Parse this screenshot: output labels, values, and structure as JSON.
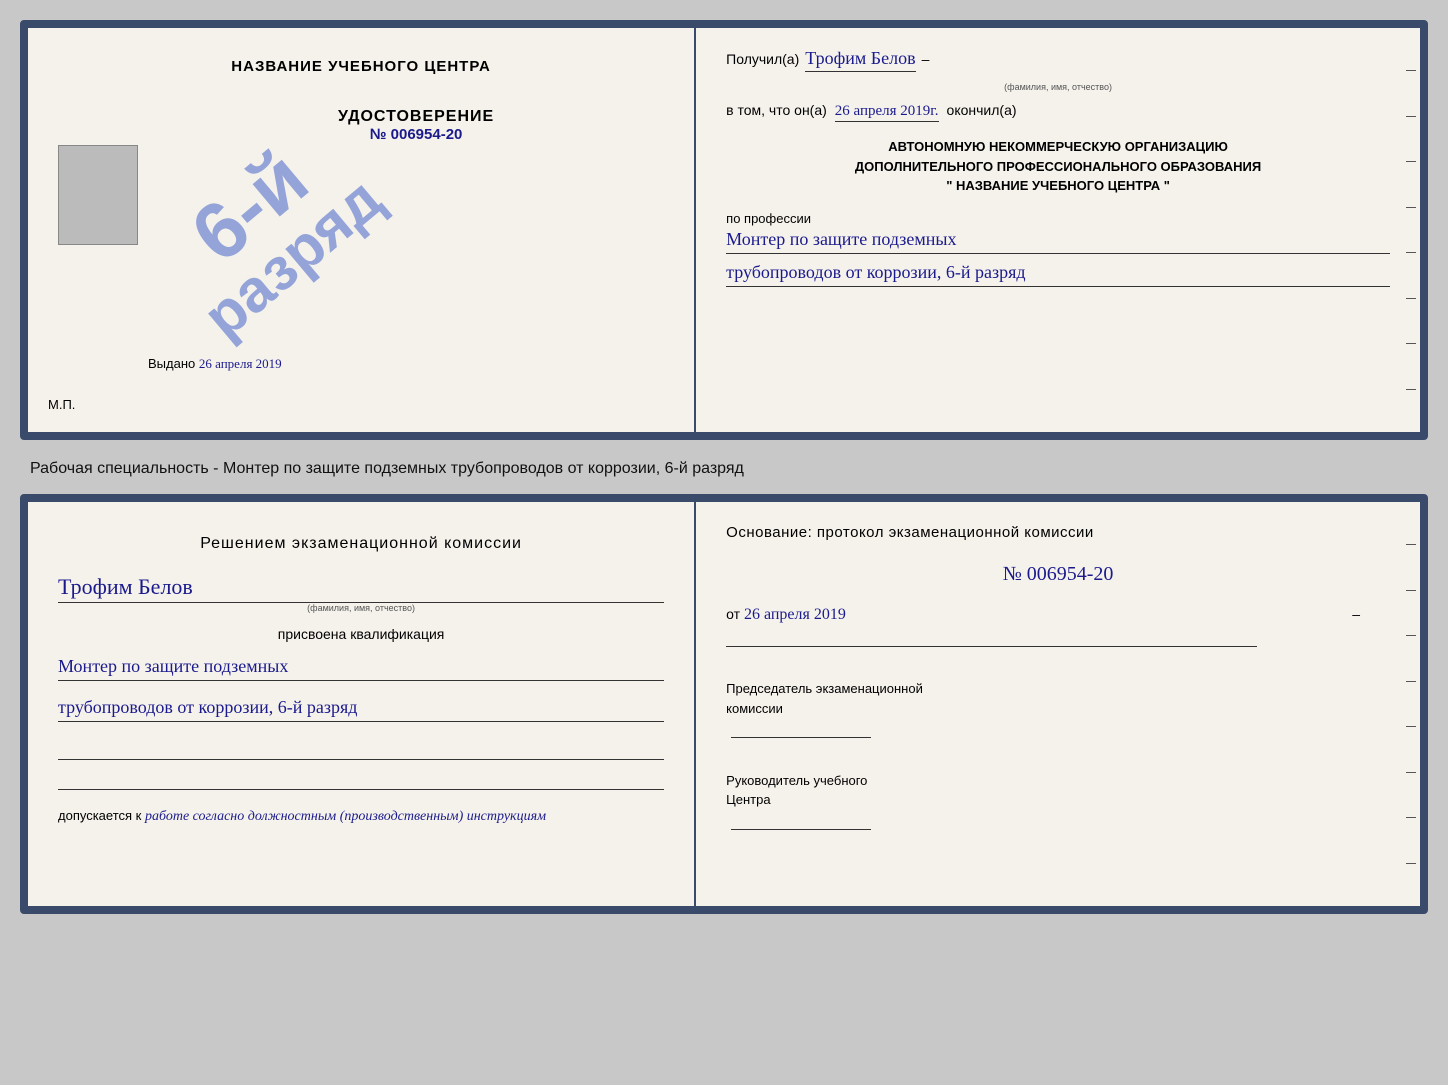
{
  "page": {
    "background": "#c8c8c8"
  },
  "top_cert": {
    "left": {
      "school_name": "НАЗВАНИЕ УЧЕБНОГО ЦЕНТРА",
      "udostoverenie_title": "УДОСТОВЕРЕНИЕ",
      "udostoverenie_number": "№ 006954-20",
      "stamp_line1": "6-й",
      "stamp_line2": "разряд",
      "vydano_label": "Выдано",
      "vydano_date": "26 апреля 2019",
      "mp_label": "М.П."
    },
    "right": {
      "poluchil_label": "Получил(а)",
      "recipient_name": "Трофим Белов",
      "recipient_caption": "(фамилия, имя, отчество)",
      "dash": "–",
      "vtom_label": "в том, что он(а)",
      "date_handwritten": "26 апреля 2019г.",
      "okonchil_label": "окончил(а)",
      "org_line1": "АВТОНОМНУЮ НЕКОММЕРЧЕСКУЮ ОРГАНИЗАЦИЮ",
      "org_line2": "ДОПОЛНИТЕЛЬНОГО ПРОФЕССИОНАЛЬНОГО ОБРАЗОВАНИЯ",
      "org_line3": "\"  НАЗВАНИЕ УЧЕБНОГО ЦЕНТРА  \"",
      "po_professii": "по профессии",
      "profession_line1": "Монтер по защите подземных",
      "profession_line2": "трубопроводов от коррозии, 6-й разряд"
    }
  },
  "between_text": "Рабочая специальность - Монтер по защите подземных трубопроводов от коррозии, 6-й разряд",
  "bottom_cert": {
    "left": {
      "resheniyem_title": "Решением экзаменационной комиссии",
      "name_handwritten": "Трофим Белов",
      "name_caption": "(фамилия, имя, отчество)",
      "prisvoena_label": "присвоена квалификация",
      "qual_line1": "Монтер по защите подземных",
      "qual_line2": "трубопроводов от коррозии, 6-й разряд",
      "dopuskaetsya_label": "допускается к",
      "dopusk_text": "работе согласно должностным (производственным) инструкциям"
    },
    "right": {
      "osnovanie_label": "Основание: протокол экзаменационной комиссии",
      "number": "№  006954-20",
      "ot_label": "от",
      "ot_date": "26 апреля 2019",
      "predsedatel_line1": "Председатель экзаменационной",
      "predsedatel_line2": "комиссии",
      "rukovoditel_line1": "Руководитель учебного",
      "rukovoditel_line2": "Центра"
    }
  }
}
